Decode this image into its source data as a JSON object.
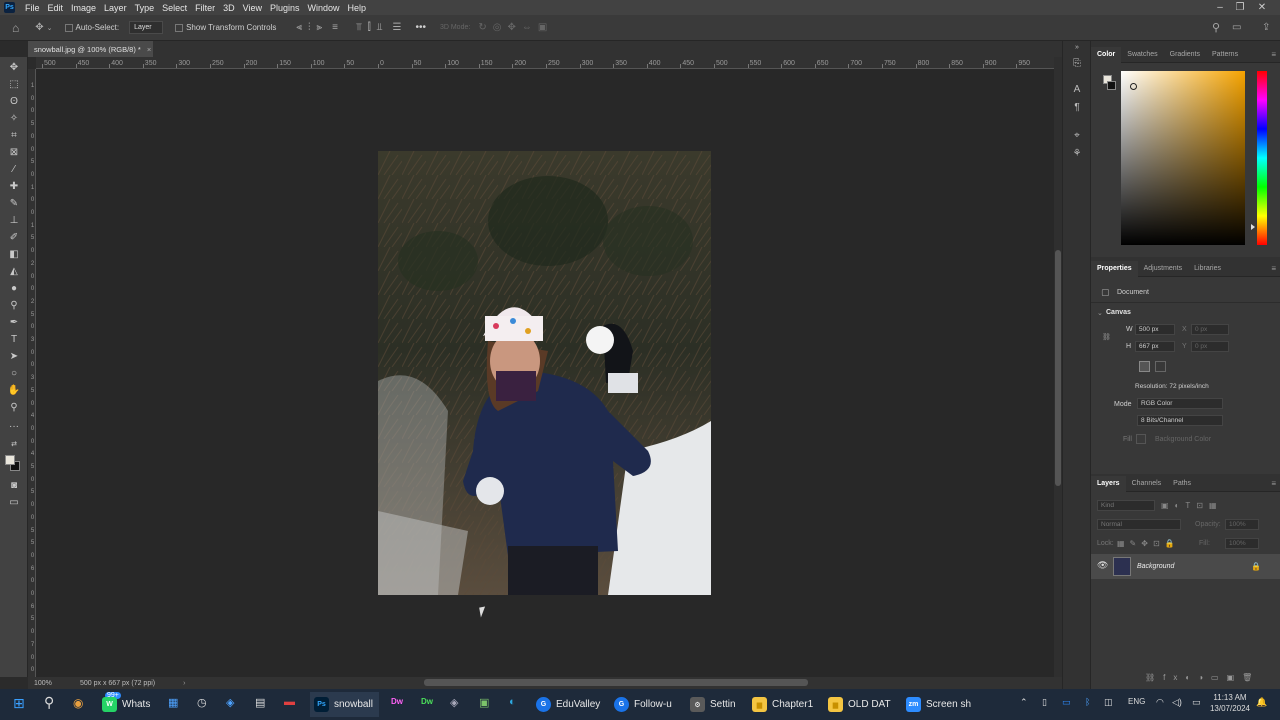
{
  "app": {
    "logo_text": "Ps",
    "name": "Photoshop"
  },
  "menu": [
    "File",
    "Edit",
    "Image",
    "Layer",
    "Type",
    "Select",
    "Filter",
    "3D",
    "View",
    "Plugins",
    "Window",
    "Help"
  ],
  "options_bar": {
    "auto_select_label": "Auto-Select:",
    "auto_select_value": "Layer",
    "show_transform_label": "Show Transform Controls",
    "more": "•••",
    "mode_3d": "3D Mode:"
  },
  "document": {
    "tab_title": "snowball.jpg @ 100% (RGB/8) *",
    "close": "×"
  },
  "ruler_top_labels": [
    "500",
    "450",
    "400",
    "350",
    "300",
    "250",
    "200",
    "150",
    "100",
    "50",
    "0",
    "50",
    "100",
    "150",
    "200",
    "250",
    "300",
    "350",
    "400",
    "450",
    "500",
    "550",
    "600",
    "650",
    "700",
    "750",
    "800",
    "850",
    "900",
    "950"
  ],
  "ruler_left_labels": [
    "1",
    "0",
    "0",
    "5",
    "0",
    "0",
    "5",
    "0",
    "1",
    "0",
    "0",
    "1",
    "5",
    "0",
    "2",
    "0",
    "0",
    "2",
    "5",
    "0",
    "3",
    "0",
    "0",
    "3",
    "5",
    "0",
    "4",
    "0",
    "0",
    "4",
    "5",
    "0",
    "5",
    "0",
    "0",
    "5",
    "5",
    "0",
    "6",
    "0",
    "0",
    "6",
    "5",
    "0",
    "7",
    "0",
    "0"
  ],
  "status": {
    "zoom": "100%",
    "doc_info": "500 px x 667 px (72 ppi)",
    "arrow": "›"
  },
  "color_panel": {
    "tabs": [
      "Color",
      "Swatches",
      "Gradients",
      "Patterns"
    ],
    "hue_color": "#f5a300"
  },
  "properties_panel": {
    "tabs": [
      "Properties",
      "Adjustments",
      "Libraries"
    ],
    "doc_label": "Document",
    "canvas_label": "Canvas",
    "w_label": "W",
    "w_value": "500 px",
    "h_label": "H",
    "h_value": "667 px",
    "x_label": "X",
    "x_value": "0 px",
    "y_label": "Y",
    "y_value": "0 px",
    "resolution": "Resolution: 72 pixels/inch",
    "mode_label": "Mode",
    "mode_value": "RGB Color",
    "bits_value": "8 Bits/Channel",
    "fill_label": "Fill",
    "fill_value": "Background Color"
  },
  "layers_panel": {
    "tabs": [
      "Layers",
      "Channels",
      "Paths"
    ],
    "kind_placeholder": "Kind",
    "blend_mode": "Normal",
    "opacity_label": "Opacity:",
    "opacity_value": "100%",
    "lock_label": "Lock:",
    "fill_label": "Fill:",
    "fill_value": "100%",
    "layer_name": "Background"
  },
  "taskbar": {
    "badge": "99+",
    "apps": [
      {
        "label": "Whats",
        "color": "#25d366",
        "icon": "W"
      },
      {
        "label": "snowball",
        "color": "#001e36",
        "icon": "Ps"
      },
      {
        "label": "EduValley",
        "color": "#1a73e8",
        "icon": "G"
      },
      {
        "label": "Follow-u",
        "color": "#1a73e8",
        "icon": "G"
      },
      {
        "label": "Settin",
        "color": "#5a5a5a",
        "icon": "⚙"
      },
      {
        "label": "Chapter1",
        "color": "#f4c542",
        "icon": "▆"
      },
      {
        "label": "OLD DAT",
        "color": "#f4c542",
        "icon": "▆"
      },
      {
        "label": "Screen sh",
        "color": "#2d8cff",
        "icon": "zm"
      }
    ],
    "lang": "ENG",
    "time": "11:13 AM",
    "date": "13/07/2024"
  }
}
